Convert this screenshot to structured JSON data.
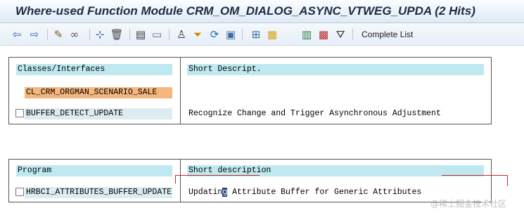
{
  "window": {
    "title": "Where-used Function Module CRM_OM_DIALOG_ASYNC_VTWEG_UPDA (2 Hits)"
  },
  "toolbar": {
    "buttons": [
      {
        "name": "back-arrow-icon",
        "glyph": "⇦",
        "color": "#2c5fb4"
      },
      {
        "name": "forward-arrow-icon",
        "glyph": "⇨",
        "color": "#2c5fb4"
      },
      {
        "name": "pencil-icon",
        "glyph": "✎",
        "color": "#7a5a1f"
      },
      {
        "name": "glasses-display-icon",
        "glyph": "∞",
        "color": "#555555"
      },
      {
        "name": "hierarchy-icon",
        "glyph": "⊹",
        "color": "#2b4f8a"
      },
      {
        "name": "trash-icon",
        "glyph": "🗑",
        "color": "#444444"
      },
      {
        "name": "print-icon",
        "glyph": "▤",
        "color": "#333333"
      },
      {
        "name": "display-list-icon",
        "glyph": "▭",
        "color": "#556a8a"
      },
      {
        "name": "find-icon",
        "glyph": "♙",
        "color": "#333333"
      },
      {
        "name": "filter-funnel-icon",
        "glyph": "⏷",
        "color": "#d08a00"
      },
      {
        "name": "refresh-icon",
        "glyph": "⟳",
        "color": "#1f6fb8"
      },
      {
        "name": "where-used-icon",
        "glyph": "▣",
        "color": "#3a6ea5"
      },
      {
        "name": "select-all-icon",
        "glyph": "⊞",
        "color": "#2b6ea3"
      },
      {
        "name": "deselect-icon",
        "glyph": "▦",
        "color": "#d3a31a"
      },
      {
        "name": "list-detail-icon",
        "glyph": "▥",
        "color": "#2d7a3a"
      },
      {
        "name": "export-icon",
        "glyph": "▩",
        "color": "#b52a2a"
      },
      {
        "name": "funnel-icon",
        "glyph": "⛛",
        "color": "#333333"
      }
    ],
    "complete_list_label": "Complete List"
  },
  "classes_table": {
    "col1_header": "Classes/Interfaces",
    "col2_header": "Short Descript.",
    "class_name": "CL_CRM_ORGMAN_SCENARIO_SALE",
    "rows": [
      {
        "name": "BUFFER_DETECT_UPDATE",
        "description": "Recognize Change and Trigger Asynchronous Adjustment"
      }
    ]
  },
  "program_table": {
    "col1_header": "Program",
    "col2_header": "Short description",
    "rows": [
      {
        "name": "HRBCI_ATTRIBUTES_BUFFER_UPDATE",
        "desc_before": "Updatin",
        "desc_cursor": "g",
        "desc_after": " Attribute Buffer for Generic Attributes"
      }
    ]
  },
  "watermark": "@稀土掘金技术社区"
}
